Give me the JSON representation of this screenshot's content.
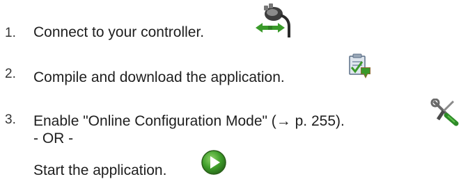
{
  "steps": [
    {
      "number": "1.",
      "text": "Connect to your controller.",
      "icon": "connect-plug-icon"
    },
    {
      "number": "2.",
      "text": "Compile and download the application.",
      "icon": "compile-download-icon"
    },
    {
      "number": "3.",
      "text": "Enable \"Online Configuration Mode\" (→ p. 255).",
      "icon": "online-config-tools-icon",
      "alternative": "- OR -",
      "alt_text": "Start the application.",
      "alt_icon": "start-play-icon"
    }
  ],
  "colors": {
    "text": "#1e1e1e",
    "icon_green": "#3a9a2a",
    "icon_gray": "#4a4a4a"
  }
}
